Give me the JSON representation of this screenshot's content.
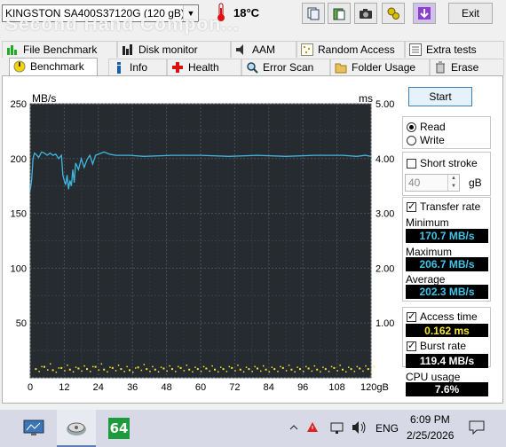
{
  "app": {
    "drive": "KINGSTON SA400S37120G (120 gB)",
    "temperature": "18°C",
    "exit_label": "Exit",
    "watermark": "Second Hand Compon..."
  },
  "tabs_top": [
    "File Benchmark",
    "Disk monitor",
    "AAM",
    "Random Access",
    "Extra tests"
  ],
  "tabs_bottom": [
    "Benchmark",
    "Info",
    "Health",
    "Error Scan",
    "Folder Usage",
    "Erase"
  ],
  "controls": {
    "start_label": "Start",
    "read_label": "Read",
    "write_label": "Write",
    "short_stroke_label": "Short stroke",
    "stroke_value": "40",
    "stroke_unit": "gB",
    "transfer_rate_label": "Transfer rate",
    "minimum_label": "Minimum",
    "minimum_value": "170.7 MB/s",
    "maximum_label": "Maximum",
    "maximum_value": "206.7 MB/s",
    "average_label": "Average",
    "average_value": "202.3 MB/s",
    "access_time_label": "Access time",
    "access_time_value": "0.162 ms",
    "burst_rate_label": "Burst rate",
    "burst_rate_value": "119.4 MB/s",
    "cpu_usage_label": "CPU usage",
    "cpu_usage_value": "7.6%"
  },
  "chart_data": {
    "type": "line",
    "left_unit": "MB/s",
    "right_unit": "ms",
    "x_ticks": [
      "0",
      "12",
      "24",
      "36",
      "48",
      "60",
      "72",
      "84",
      "96",
      "108",
      "120gB"
    ],
    "y_ticks_left": [
      "250",
      "200",
      "150",
      "100",
      "50"
    ],
    "y_ticks_right": [
      "5.00",
      "4.00",
      "3.00",
      "2.00",
      "1.00"
    ],
    "xlim": [
      0,
      120
    ],
    "ylim_left": [
      0,
      250
    ],
    "ylim_right": [
      0,
      5
    ],
    "grid": true,
    "series": [
      {
        "color": "#3fb6e0",
        "x": [
          0,
          0.5,
          1,
          1.5,
          2,
          3,
          4,
          5,
          6,
          7,
          8,
          9,
          10,
          11,
          11.5,
          12,
          12.5,
          13,
          13.5,
          14,
          14.5,
          15,
          15.5,
          16,
          17,
          18,
          19,
          20,
          21,
          22,
          23,
          24,
          26,
          28,
          30,
          35,
          40,
          50,
          60,
          70,
          80,
          90,
          100,
          110,
          115,
          118,
          120
        ],
        "y": [
          171,
          180,
          200,
          205,
          204,
          201,
          206,
          205,
          203,
          205,
          203,
          204,
          200,
          203,
          185,
          180,
          176,
          185,
          172,
          180,
          175,
          190,
          178,
          196,
          190,
          200,
          192,
          199,
          203,
          195,
          203,
          204,
          206,
          204,
          203,
          203,
          202,
          203,
          203,
          202,
          203,
          202,
          203,
          203,
          202,
          203,
          202
        ]
      },
      {
        "color": "#f2e534",
        "type": "scatter",
        "note_y_axis": "right",
        "x": [
          2,
          5,
          8,
          11,
          14,
          17,
          20,
          23,
          26,
          29,
          32,
          35,
          38,
          41,
          44,
          47,
          50,
          53,
          56,
          59,
          62,
          65,
          68,
          71,
          74,
          77,
          80,
          83,
          86,
          89,
          92,
          95,
          98,
          101,
          104,
          107,
          110,
          113,
          116,
          119
        ],
        "y": [
          0.16,
          0.2,
          0.14,
          0.18,
          0.15,
          0.17,
          0.16,
          0.2,
          0.15,
          0.18,
          0.16,
          0.14,
          0.19,
          0.16,
          0.15,
          0.17,
          0.16,
          0.18,
          0.15,
          0.16,
          0.17,
          0.15,
          0.16,
          0.18,
          0.15,
          0.16,
          0.17,
          0.15,
          0.16,
          0.18,
          0.15,
          0.16,
          0.17,
          0.15,
          0.16,
          0.18,
          0.15,
          0.16,
          0.17,
          0.16
        ]
      }
    ]
  },
  "taskbar": {
    "pinned": [
      "monitor-icon",
      "hd-tune-icon",
      "cpuid-64-icon"
    ],
    "cpuid_label": "64",
    "language": "ENG",
    "time": "6:09 PM",
    "date": "2/25/2026"
  }
}
